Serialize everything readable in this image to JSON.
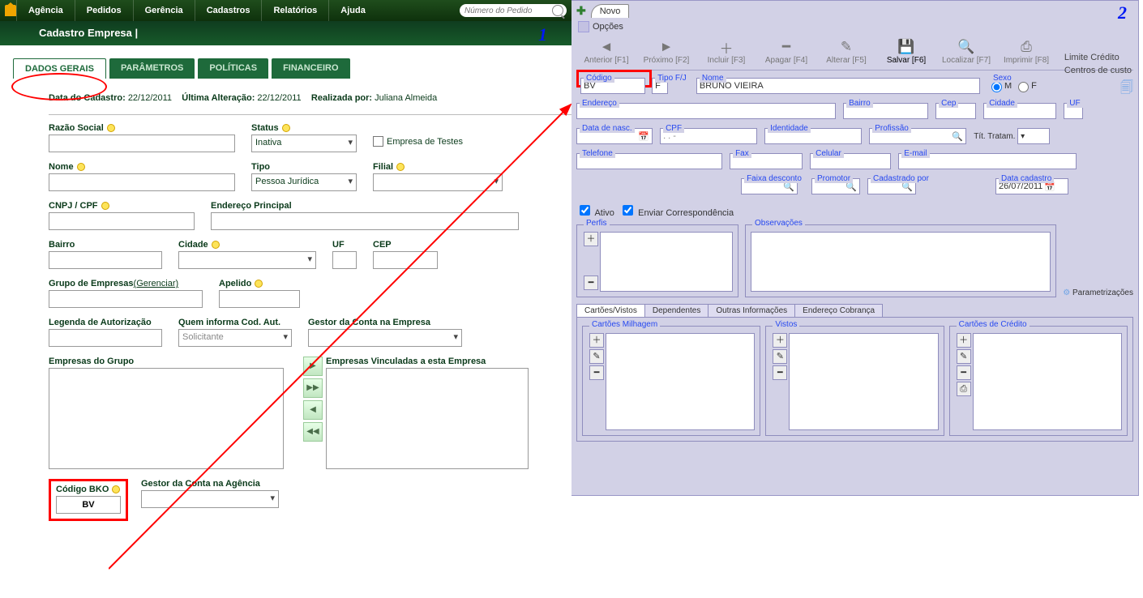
{
  "nav": {
    "items": [
      "Agência",
      "Pedidos",
      "Gerência",
      "Cadastros",
      "Relatórios",
      "Ajuda"
    ],
    "search_ph": "Número do Pedido"
  },
  "sub": {
    "title": "Cadastro Empresa |"
  },
  "callouts": {
    "one": "1",
    "two": "2"
  },
  "tabs": [
    "DADOS GERAIS",
    "PARÂMETROS",
    "POLÍTICAS",
    "FINANCEIRO"
  ],
  "meta": {
    "label1": "Data do Cadastro:",
    "val1": "22/12/2011",
    "label2": "Última Alteração:",
    "val2": "22/12/2011",
    "label3": "Realizada por:",
    "val3": "Juliana Almeida"
  },
  "f": {
    "razao": "Razão Social",
    "status": "Status",
    "status_val": "Inativa",
    "testes": "Empresa de Testes",
    "nome": "Nome",
    "tipo": "Tipo",
    "tipo_val": "Pessoa Jurídica",
    "filial": "Filial",
    "cnpj": "CNPJ / CPF",
    "endereco": "Endereço Principal",
    "bairro": "Bairro",
    "cidade": "Cidade",
    "uf": "UF",
    "cep": "CEP",
    "grupo": "Grupo de Empresas",
    "gerenciar": "(Gerenciar)",
    "apelido": "Apelido",
    "legenda": "Legenda de Autorização",
    "quem": "Quem informa Cod. Aut.",
    "quem_val": "Solicitante",
    "gestor_emp": "Gestor da Conta na Empresa",
    "emp_grupo": "Empresas do Grupo",
    "emp_vinc": "Empresas Vinculadas a esta Empresa",
    "codigo_bko": "Código BKO",
    "codigo_bko_val": "BV",
    "gestor_ag": "Gestor da Conta na Agência"
  },
  "r": {
    "novo": "Novo",
    "opcoes": "Opções",
    "tb": {
      "anterior": "Anterior [F1]",
      "proximo": "Próximo [F2]",
      "incluir": "Incluir [F3]",
      "apagar": "Apagar [F4]",
      "alterar": "Alterar [F5]",
      "salvar": "Salvar [F6]",
      "localizar": "Localizar [F7]",
      "imprimir": "Imprimir [F8]"
    },
    "icons": {
      "anterior": "◄",
      "proximo": "►",
      "incluir": "＋",
      "apagar": "━",
      "alterar": "✎",
      "salvar": "💾",
      "localizar": "🔍",
      "imprimir": "⎙"
    },
    "side": {
      "limite": "Limite Crédito",
      "centros": "Centros de custo",
      "param": "Parametrizações"
    },
    "codigo": "Código",
    "codigo_val": "BV",
    "tipofj": "Tipo F/J",
    "tipofj_val": "F",
    "nome": "Nome",
    "nome_val": "BRUNO VIEIRA",
    "sexo": "Sexo",
    "m": "M",
    "f": "F",
    "endereco": "Endereço",
    "bairro": "Bairro",
    "cep": "Cep",
    "cidade": "Cidade",
    "uf": "UF",
    "dn": "Data de nasc.",
    "cpf": "CPF",
    "cpf_mask": ". . -",
    "ident": "Identidade",
    "prof": "Profissão",
    "tit": "Tít. Tratam.",
    "tel": "Telefone",
    "fax": "Fax",
    "cel": "Celular",
    "email": "E-mail",
    "faixa": "Faixa desconto",
    "promotor": "Promotor",
    "cadpor": "Cadastrado por",
    "datacad": "Data cadastro",
    "datacad_val": "26/07/2011",
    "ativo": "Ativo",
    "enviar": "Enviar Correspondência",
    "perfis": "Perfis",
    "obs": "Observações",
    "tabs": [
      "Cartões/Vistos",
      "Dependentes",
      "Outras Informações",
      "Endereço Cobrança"
    ],
    "milhagem": "Cartões Milhagem",
    "vistos": "Vistos",
    "credito": "Cartões de Crédito"
  }
}
